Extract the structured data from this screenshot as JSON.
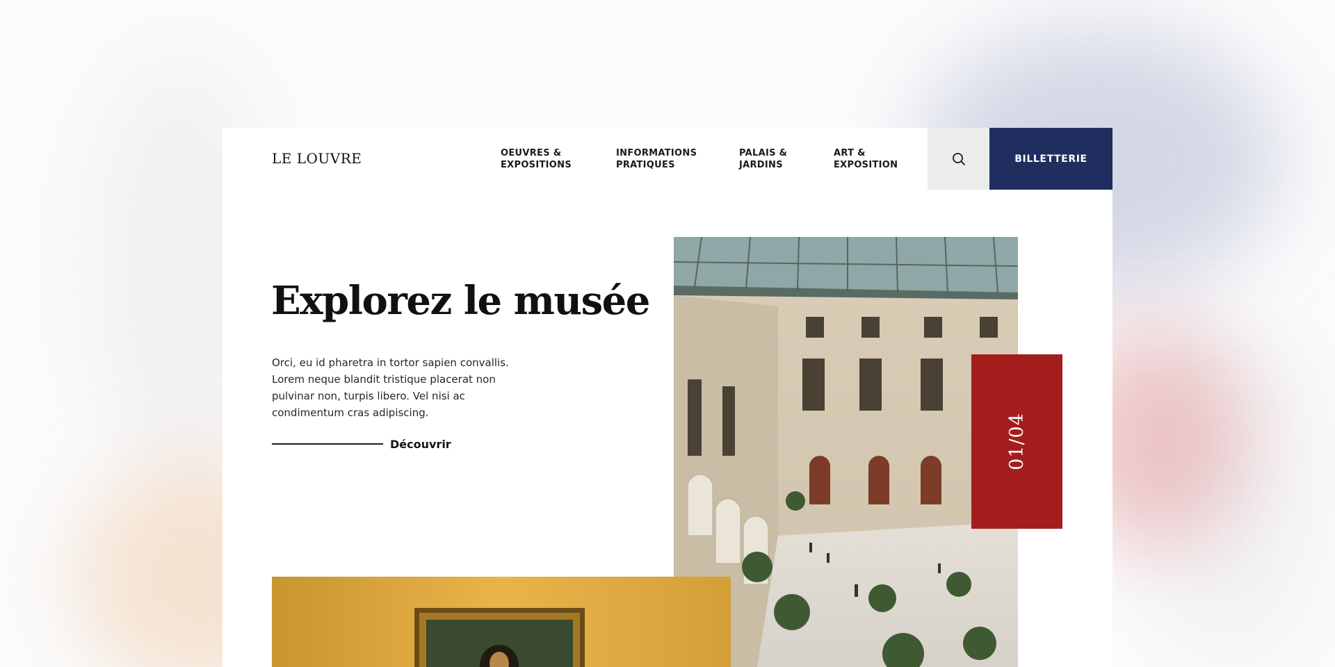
{
  "brand": {
    "logo": "LE LOUVRE"
  },
  "nav": {
    "items": [
      {
        "label": "OEUVRES &\nEXPOSITIONS"
      },
      {
        "label": "INFORMATIONS\nPRATIQUES"
      },
      {
        "label": "PALAIS &\nJARDINS"
      },
      {
        "label": "ART &\nEXPOSITION"
      }
    ],
    "search_icon": "search-icon",
    "ticket_label": "BILLETTERIE"
  },
  "hero": {
    "title": "Explorez le musée",
    "description": "Orci, eu id pharetra in tortor sapien convallis. Lorem neque blandit tristique placerat non pulvinar non, turpis libero. Vel nisi ac condimentum cras adipiscing.",
    "cta_label": "Découvrir",
    "slide_counter": "01/04"
  },
  "colors": {
    "accent_navy": "#1f2d5f",
    "accent_red": "#a41d1d",
    "search_bg": "#ececec"
  }
}
